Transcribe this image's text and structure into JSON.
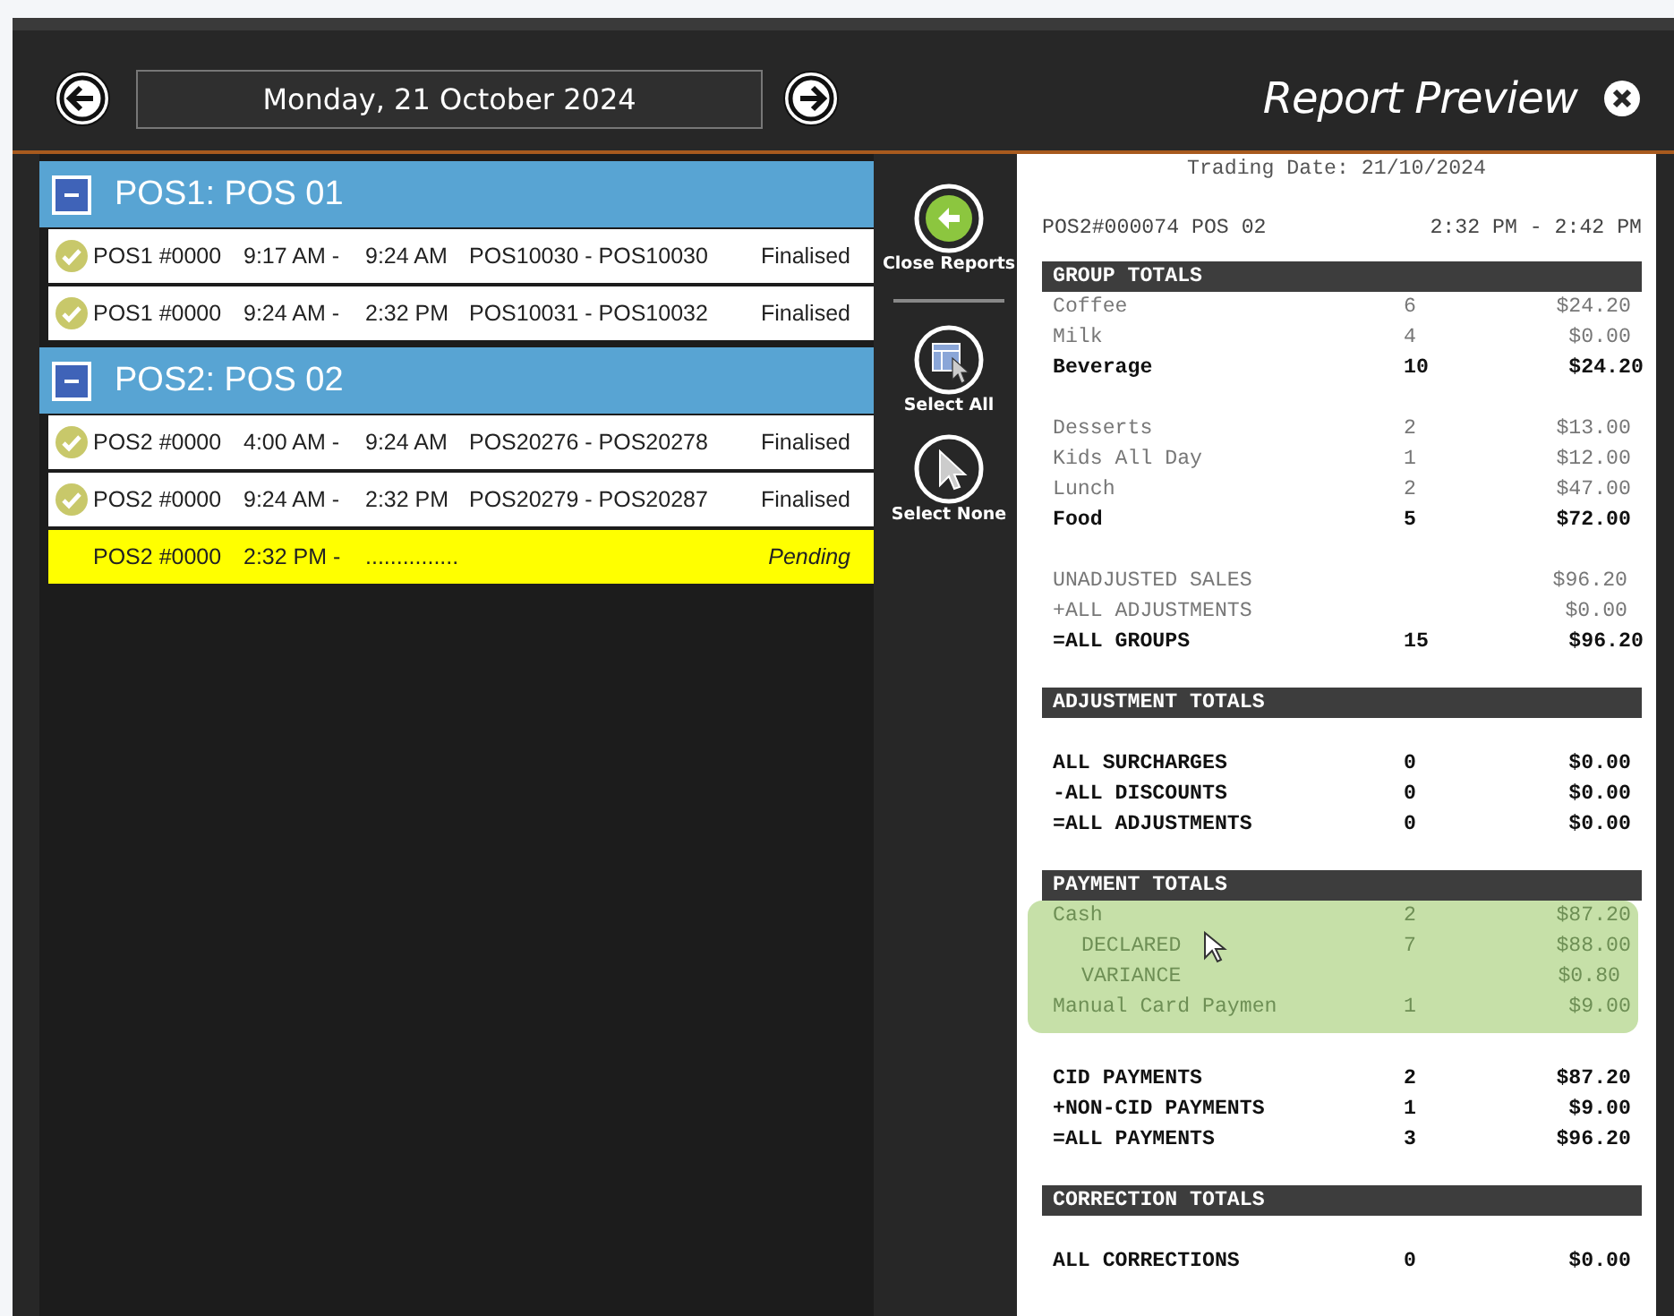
{
  "nav": {
    "date": "Monday, 21 October 2024",
    "title": "Report Preview"
  },
  "groups": [
    {
      "title": "POS1: POS 01",
      "expanded": true,
      "sessions": [
        {
          "register": "POS1 #0000",
          "start": "9:17 AM -",
          "end": "9:24 AM",
          "range": "POS10030 - POS10030",
          "status": "Finalised",
          "pending": false
        },
        {
          "register": "POS1 #0000",
          "start": "9:24 AM -",
          "end": "2:32 PM",
          "range": "POS10031 - POS10032",
          "status": "Finalised",
          "pending": false
        }
      ]
    },
    {
      "title": "POS2: POS 02",
      "expanded": true,
      "sessions": [
        {
          "register": "POS2 #0000",
          "start": "4:00 AM -",
          "end": "9:24 AM",
          "range": "POS20276 - POS20278",
          "status": "Finalised",
          "pending": false
        },
        {
          "register": "POS2 #0000",
          "start": "9:24 AM -",
          "end": "2:32 PM",
          "range": "POS20279 - POS20287",
          "status": "Finalised",
          "pending": false
        },
        {
          "register": "POS2 #0000",
          "start": "2:32 PM -",
          "end": "...............",
          "status": "Pending",
          "pending": true
        }
      ]
    }
  ],
  "actions": [
    {
      "kind": "close",
      "label": "Close Reports"
    },
    {
      "kind": "select_all",
      "label": "Select All"
    },
    {
      "kind": "select_none",
      "label": "Select None"
    }
  ],
  "report": {
    "trading_date": "Trading Date: 21/10/2024",
    "register": "POS2#000074 POS 02",
    "period": "2:32 PM -  2:42 PM",
    "lines": [
      {
        "kind": "heading",
        "label": "GROUP TOTALS"
      },
      {
        "kind": "item",
        "label": "Coffee",
        "qty": "6",
        "amount": "$24.20",
        "bold": false,
        "highlighted": false,
        "indent": false
      },
      {
        "kind": "item",
        "label": "Milk",
        "qty": "4",
        "amount": "$0.00",
        "bold": false,
        "highlighted": false,
        "indent": false
      },
      {
        "kind": "item",
        "label": "Beverage",
        "qty": "10",
        "amount": "$24.20",
        "bold": true,
        "highlighted": false,
        "indent": false
      },
      {
        "kind": "blank"
      },
      {
        "kind": "item",
        "label": "Desserts",
        "qty": "2",
        "amount": "$13.00",
        "bold": false,
        "highlighted": false,
        "indent": false
      },
      {
        "kind": "item",
        "label": "Kids All Day",
        "qty": "1",
        "amount": "$12.00",
        "bold": false,
        "highlighted": false,
        "indent": false
      },
      {
        "kind": "item",
        "label": "Lunch",
        "qty": "2",
        "amount": "$47.00",
        "bold": false,
        "highlighted": false,
        "indent": false
      },
      {
        "kind": "item",
        "label": "Food",
        "qty": "5",
        "amount": "$72.00",
        "bold": true,
        "highlighted": false,
        "indent": false
      },
      {
        "kind": "blank"
      },
      {
        "kind": "item",
        "label": "UNADJUSTED SALES",
        "amount": "$96.20",
        "bold": false,
        "highlighted": false,
        "indent": false
      },
      {
        "kind": "item",
        "label": "+ALL ADJUSTMENTS",
        "amount": "$0.00",
        "bold": false,
        "highlighted": false,
        "indent": false
      },
      {
        "kind": "item",
        "label": "=ALL GROUPS",
        "qty": "15",
        "amount": "$96.20",
        "bold": true,
        "highlighted": false,
        "indent": false
      },
      {
        "kind": "blank"
      },
      {
        "kind": "heading",
        "label": "ADJUSTMENT TOTALS"
      },
      {
        "kind": "blank"
      },
      {
        "kind": "item",
        "label": "ALL SURCHARGES",
        "qty": "0",
        "amount": "$0.00",
        "bold": true,
        "highlighted": false,
        "indent": false
      },
      {
        "kind": "item",
        "label": "-ALL DISCOUNTS",
        "qty": "0",
        "amount": "$0.00",
        "bold": true,
        "highlighted": false,
        "indent": false
      },
      {
        "kind": "item",
        "label": "=ALL ADJUSTMENTS",
        "qty": "0",
        "amount": "$0.00",
        "bold": true,
        "highlighted": false,
        "indent": false
      },
      {
        "kind": "blank"
      },
      {
        "kind": "heading",
        "label": "PAYMENT TOTALS"
      },
      {
        "kind": "item",
        "label": "Cash",
        "qty": "2",
        "amount": "$87.20",
        "bold": false,
        "highlighted": true,
        "indent": false
      },
      {
        "kind": "item",
        "label": "DECLARED",
        "qty": "7",
        "amount": "$88.00",
        "bold": false,
        "highlighted": true,
        "indent": true
      },
      {
        "kind": "item",
        "label": "VARIANCE",
        "amount": "$0.80",
        "bold": false,
        "highlighted": true,
        "indent": true
      },
      {
        "kind": "item",
        "label": "Manual Card Paymen",
        "qty": "1",
        "amount": "$9.00",
        "bold": false,
        "highlighted": true,
        "indent": false
      },
      {
        "kind": "blank"
      },
      {
        "kind": "item",
        "label": "CID PAYMENTS",
        "qty": "2",
        "amount": "$87.20",
        "bold": true,
        "highlighted": false,
        "indent": false
      },
      {
        "kind": "item",
        "label": "+NON-CID PAYMENTS",
        "qty": "1",
        "amount": "$9.00",
        "bold": true,
        "highlighted": false,
        "indent": false
      },
      {
        "kind": "item",
        "label": "=ALL PAYMENTS",
        "qty": "3",
        "amount": "$96.20",
        "bold": true,
        "highlighted": false,
        "indent": false
      },
      {
        "kind": "blank"
      },
      {
        "kind": "heading",
        "label": "CORRECTION TOTALS"
      },
      {
        "kind": "blank"
      },
      {
        "kind": "item",
        "label": "ALL CORRECTIONS",
        "qty": "0",
        "amount": "$0.00",
        "bold": true,
        "highlighted": false,
        "indent": false
      }
    ]
  }
}
